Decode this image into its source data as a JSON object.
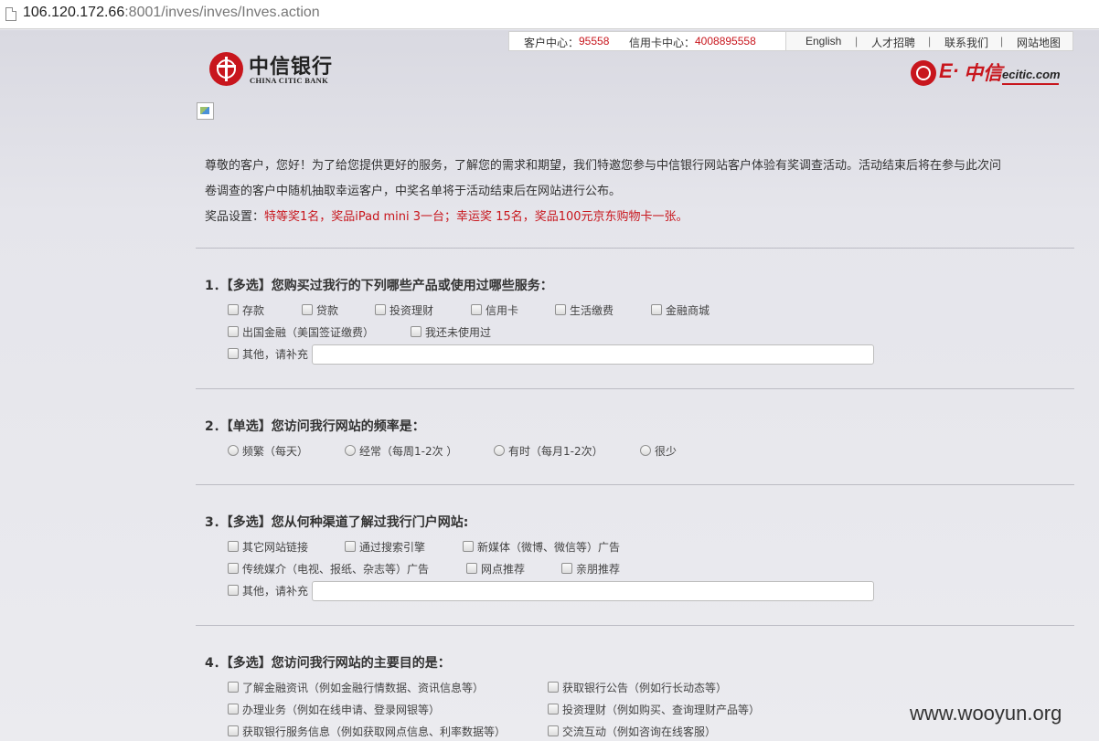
{
  "browser": {
    "url_host": "106.120.172.66",
    "url_rest": ":8001/inves/inves/Inves.action"
  },
  "toplinks": {
    "customer_center_label": "客户中心：",
    "customer_center_phone": "95558",
    "card_center_label": "信用卡中心：",
    "card_center_phone": "4008895558",
    "links": [
      "English",
      "人才招聘",
      "联系我们",
      "网站地图"
    ],
    "separator": "|"
  },
  "logo": {
    "cn": "中信银行",
    "en": "CHINA CITIC BANK",
    "right_e": "E·",
    "right_cn": "中信",
    "right_en": "ecitic.com"
  },
  "intro": {
    "line1": "尊敬的客户，您好！为了给您提供更好的服务，了解您的需求和期望，我们特邀您参与中信银行网站客户体验有奖调查活动。活动结束后将在参与此次问",
    "line2": "卷调查的客户中随机抽取幸运客户，中奖名单将于活动结束后在网站进行公布。",
    "prize_label": "奖品设置：",
    "prize_text": "特等奖1名，奖品iPad mini 3一台；幸运奖 15名，奖品100元京东购物卡一张。"
  },
  "q1": {
    "title": "1．【多选】您购买过我行的下列哪些产品或使用过哪些服务：",
    "options": [
      "存款",
      "贷款",
      "投资理财",
      "信用卡",
      "生活缴费",
      "金融商城",
      "出国金融（美国签证缴费）",
      "我还未使用过",
      "其他，请补充"
    ]
  },
  "q2": {
    "title": "2．【单选】您访问我行网站的频率是：",
    "options": [
      "频繁（每天）",
      "经常（每周1-2次 ）",
      "有时（每月1-2次）",
      "很少"
    ]
  },
  "q3": {
    "title": "3．【多选】您从何种渠道了解过我行门户网站:",
    "options": [
      "其它网站链接",
      "通过搜索引擎",
      "新媒体（微博、微信等）广告",
      "传统媒介（电视、报纸、杂志等）广告",
      "网点推荐",
      "亲朋推荐",
      "其他，请补充"
    ]
  },
  "q4": {
    "title": "4．【多选】您访问我行网站的主要目的是：",
    "options": [
      "了解金融资讯（例如金融行情数据、资讯信息等）",
      "获取银行公告（例如行长动态等）",
      "办理业务（例如在线申请、登录网银等）",
      "投资理财（例如购买、查询理财产品等）",
      "获取银行服务信息（例如获取网点信息、利率数据等）",
      "交流互动（例如咨询在线客服）"
    ]
  },
  "watermark": "www.wooyun.org",
  "colors": {
    "brand_red": "#c8161d",
    "background": "#e9e9ef"
  }
}
